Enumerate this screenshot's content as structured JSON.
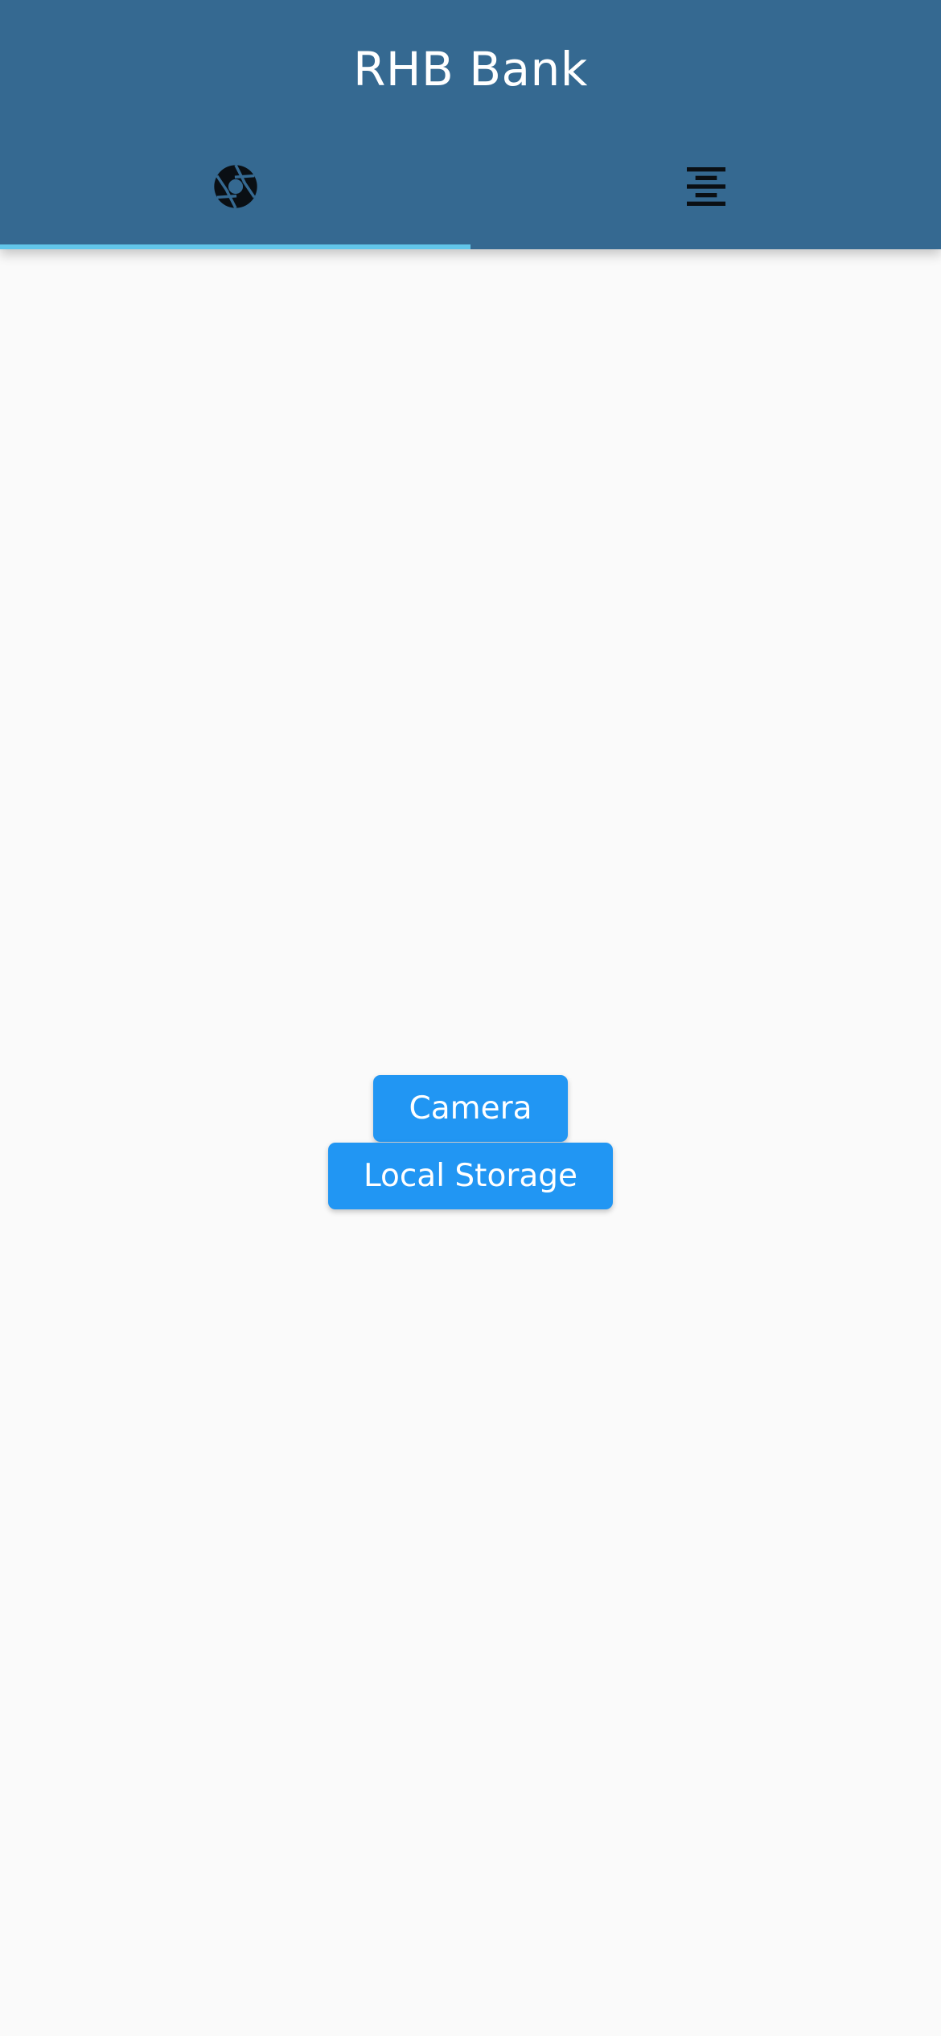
{
  "app_bar": {
    "title": "RHB Bank",
    "background_color": "#356991",
    "title_color": "#FFFFFF"
  },
  "tabs": [
    {
      "icon": "camera-aperture-icon",
      "selected": true
    },
    {
      "icon": "align-center-icon",
      "selected": false
    }
  ],
  "tab_indicator_color": "#62C6EA",
  "actions": {
    "camera_label": "Camera",
    "local_storage_label": "Local Storage",
    "button_color": "#2196F3"
  }
}
